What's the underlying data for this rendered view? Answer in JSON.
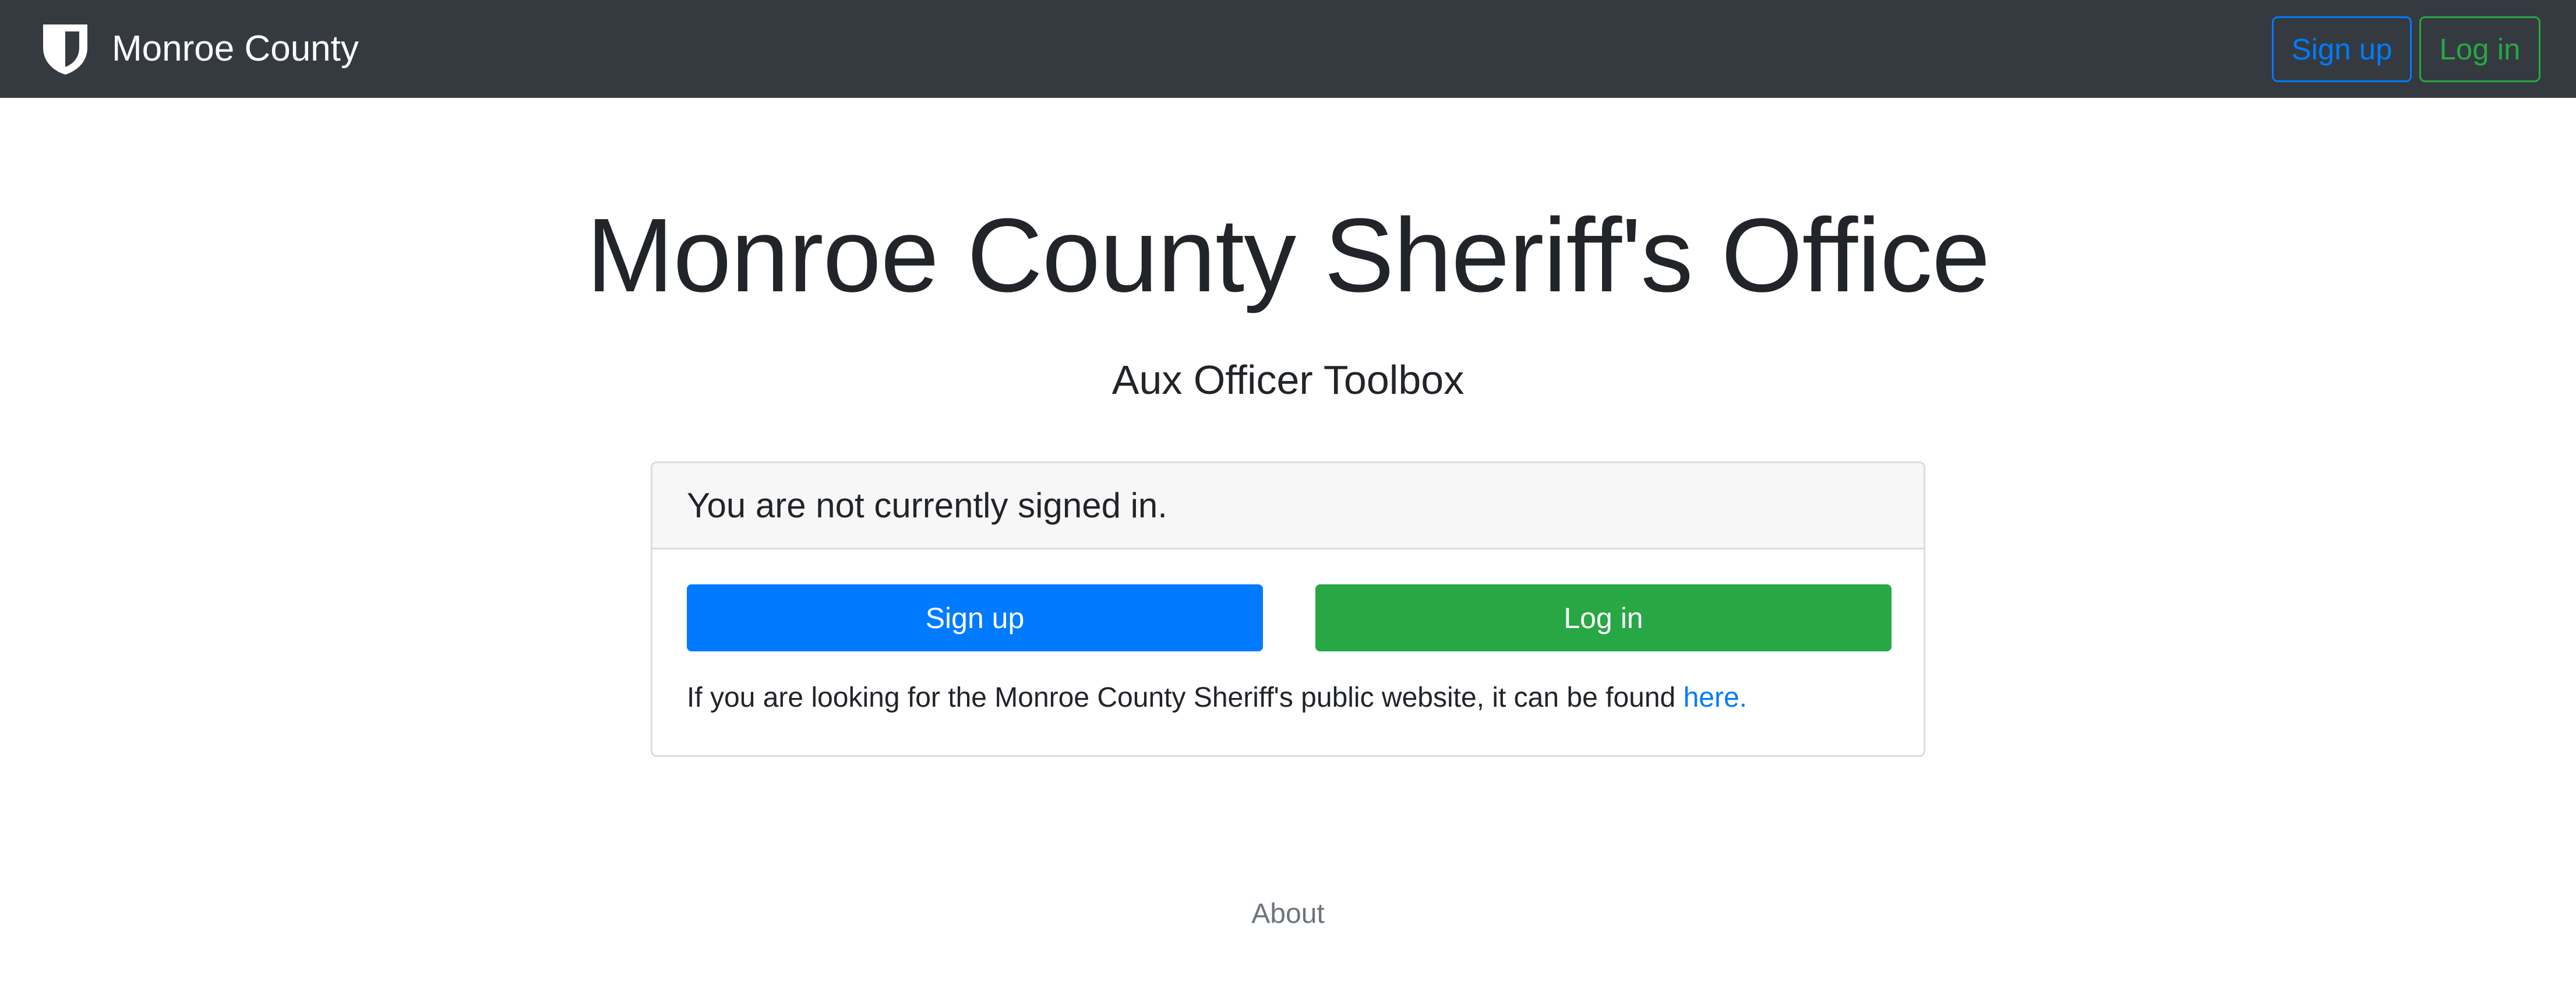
{
  "navbar": {
    "brand_icon": "shield-icon",
    "brand_text": "Monroe County",
    "signup_label": "Sign up",
    "login_label": "Log in",
    "background": "#343a40"
  },
  "hero": {
    "title": "Monroe County Sheriff's Office",
    "subtitle": "Aux Officer Toolbox"
  },
  "card": {
    "header": "You are not currently signed in.",
    "signup_label": "Sign up",
    "login_label": "Log in",
    "note_text": "If you are looking for the Monroe County Sheriff's public website, it can be found ",
    "note_link": "here."
  },
  "footer": {
    "about_label": "About"
  },
  "colors": {
    "primary": "#007bff",
    "success": "#28a745",
    "muted": "#6c757d",
    "text": "#212529"
  }
}
